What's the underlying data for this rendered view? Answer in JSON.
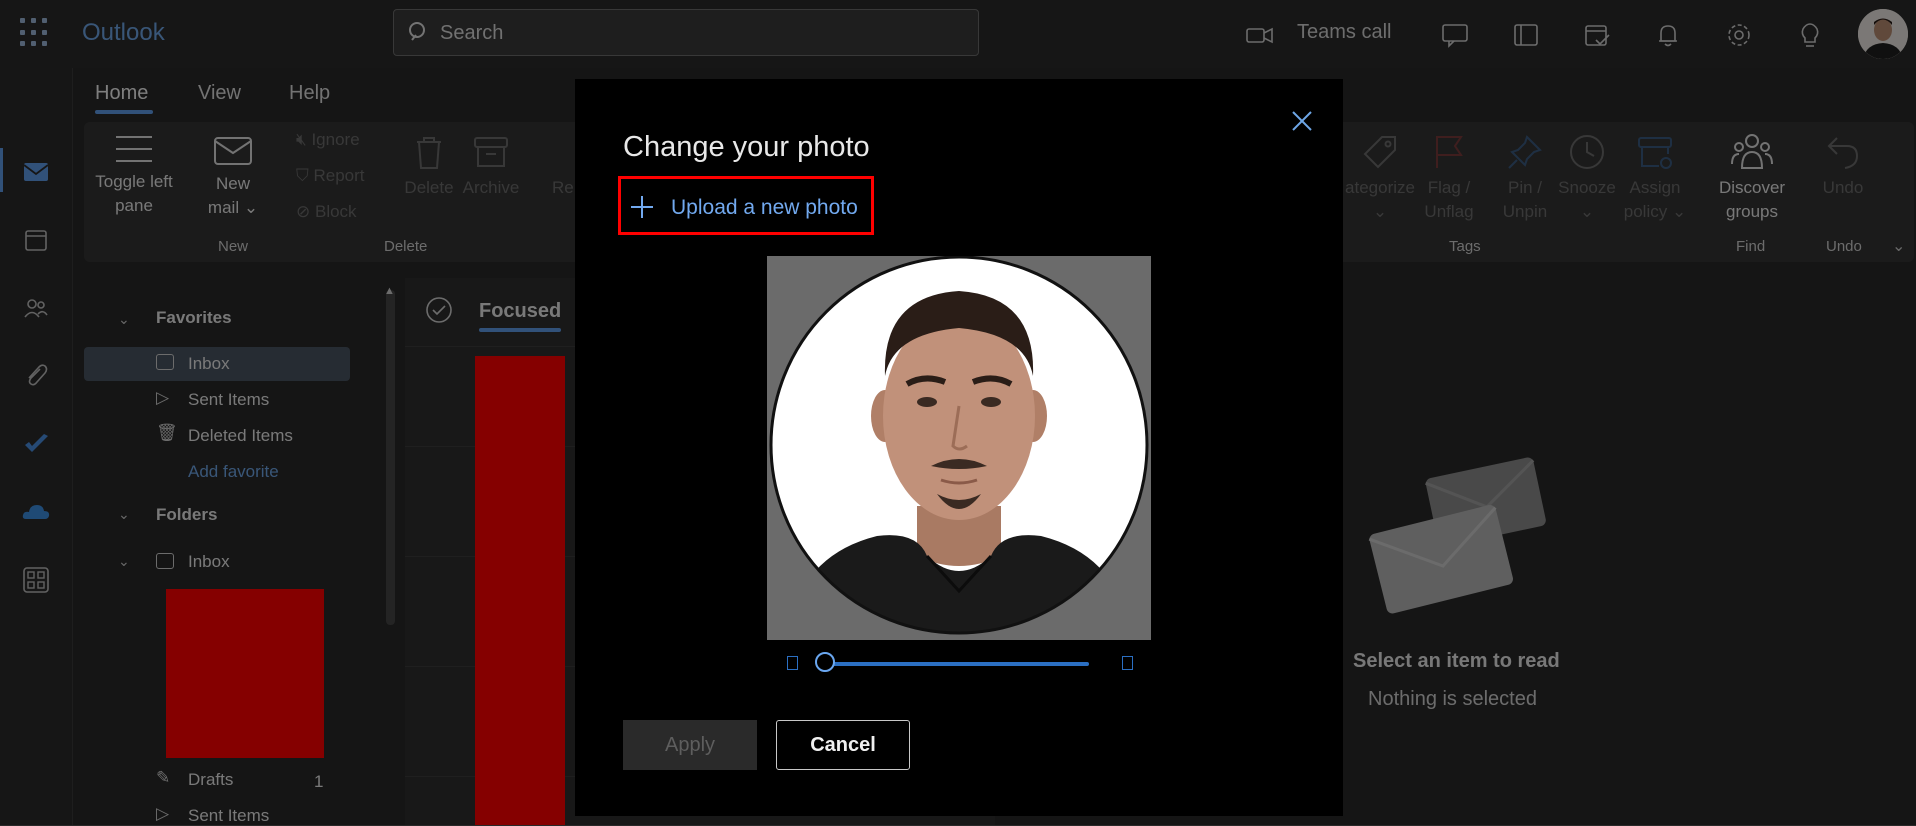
{
  "app": {
    "title": "Outlook"
  },
  "search": {
    "placeholder": "Search"
  },
  "topbar": {
    "teams_call": "Teams call"
  },
  "tabs": [
    {
      "label": "Home"
    },
    {
      "label": "View"
    },
    {
      "label": "Help"
    }
  ],
  "ribbon": {
    "toggle_left_pane_1": "Toggle left",
    "toggle_left_pane_2": "pane",
    "new_mail_1": "New",
    "new_mail_2": "mail",
    "ignore": "Ignore",
    "report": "Report",
    "block": "Block",
    "delete": "Delete",
    "archive": "Archive",
    "reply_partial": "Re",
    "categorize": "ategorize",
    "flag_1": "Flag /",
    "flag_2": "Unflag",
    "pin_1": "Pin /",
    "pin_2": "Unpin",
    "snooze": "Snooze",
    "assign_1": "Assign",
    "assign_2": "policy",
    "discover_1": "Discover",
    "discover_2": "groups",
    "undo": "Undo",
    "groups": {
      "new": "New",
      "delete": "Delete",
      "tags": "Tags",
      "find": "Find",
      "undo": "Undo"
    }
  },
  "folder_pane": {
    "favorites": "Favorites",
    "fav_items": [
      "Inbox",
      "Sent Items",
      "Deleted Items"
    ],
    "add_favorite": "Add favorite",
    "folders": "Folders",
    "inbox": "Inbox",
    "drafts": "Drafts",
    "drafts_count": "1",
    "sent_items": "Sent Items"
  },
  "message_list": {
    "focused_tab": "Focused"
  },
  "reading_pane": {
    "title": "Select an item to read",
    "subtitle": "Nothing is selected"
  },
  "dialog": {
    "title": "Change your photo",
    "upload_label": "Upload a new photo",
    "zoom_level": 0.0,
    "apply": "Apply",
    "cancel": "Cancel"
  },
  "colors": {
    "accent": "#5f9ce8",
    "highlight_box": "#ff0000",
    "link": "#72a9ef"
  }
}
